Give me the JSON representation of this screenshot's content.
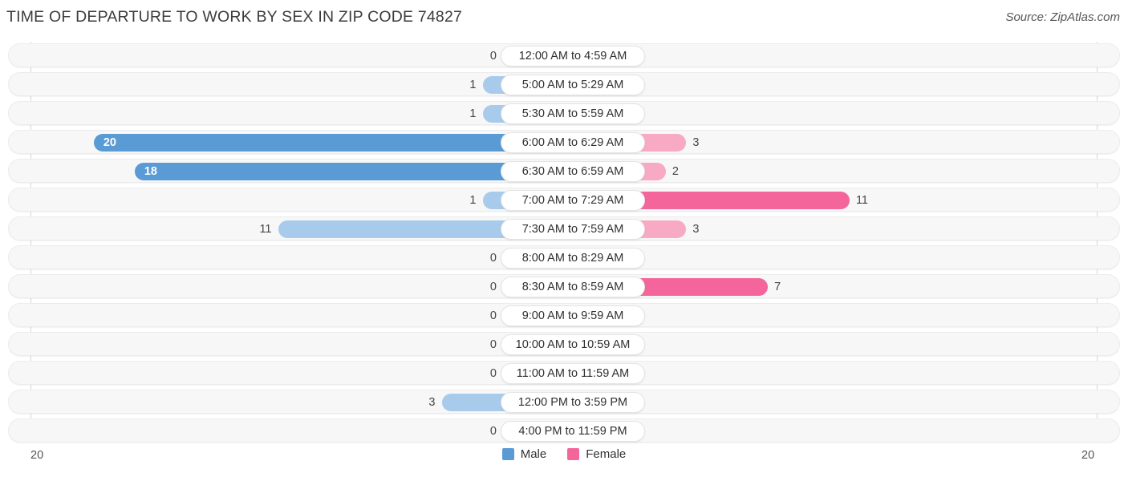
{
  "header": {
    "title": "TIME OF DEPARTURE TO WORK BY SEX IN ZIP CODE 74827",
    "source": "Source: ZipAtlas.com"
  },
  "axis": {
    "left_tick": "20",
    "right_tick": "20",
    "max": 20
  },
  "legend": {
    "items": [
      {
        "label": "Male",
        "color": "#5b9bd5"
      },
      {
        "label": "Female",
        "color": "#f4669b"
      }
    ]
  },
  "colors": {
    "male_light": "#a8cbec",
    "male_dark": "#5b9bd5",
    "female_light": "#f8a9c4",
    "female_dark": "#f4669b",
    "track": "#f7f7f7",
    "text": "#3c3c3c"
  },
  "chart_data": {
    "type": "bar",
    "title": "TIME OF DEPARTURE TO WORK BY SEX IN ZIP CODE 74827",
    "subtitle": "",
    "orientation": "horizontal-diverging",
    "xlabel": "",
    "ylabel": "",
    "xlim": [
      20,
      20
    ],
    "grid": false,
    "legend_position": "bottom-center",
    "categories": [
      "12:00 AM to 4:59 AM",
      "5:00 AM to 5:29 AM",
      "5:30 AM to 5:59 AM",
      "6:00 AM to 6:29 AM",
      "6:30 AM to 6:59 AM",
      "7:00 AM to 7:29 AM",
      "7:30 AM to 7:59 AM",
      "8:00 AM to 8:29 AM",
      "8:30 AM to 8:59 AM",
      "9:00 AM to 9:59 AM",
      "10:00 AM to 10:59 AM",
      "11:00 AM to 11:59 AM",
      "12:00 PM to 3:59 PM",
      "4:00 PM to 11:59 PM"
    ],
    "series": [
      {
        "name": "Male",
        "direction": "left",
        "color": "#5b9bd5",
        "values": [
          0,
          1,
          1,
          20,
          18,
          1,
          11,
          0,
          0,
          0,
          0,
          0,
          3,
          0
        ],
        "labels": [
          "0",
          "1",
          "1",
          "20",
          "18",
          "1",
          "11",
          "0",
          "0",
          "0",
          "0",
          "0",
          "3",
          "0"
        ]
      },
      {
        "name": "Female",
        "direction": "right",
        "color": "#f4669b",
        "values": [
          0,
          0,
          0,
          3,
          2,
          11,
          3,
          0,
          7,
          0,
          0,
          0,
          0,
          0
        ],
        "labels": [
          "0",
          "0",
          "0",
          "3",
          "2",
          "11",
          "3",
          "0",
          "7",
          "0",
          "0",
          "0",
          "0",
          "0"
        ]
      }
    ]
  }
}
